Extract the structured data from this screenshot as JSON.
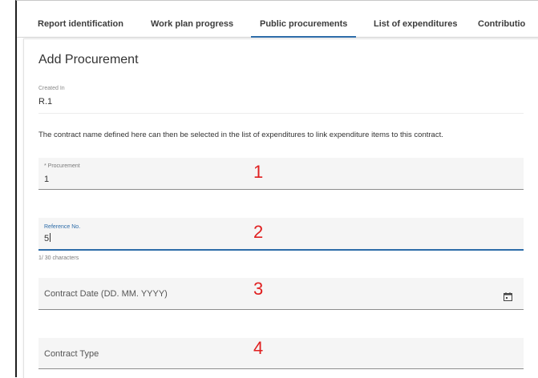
{
  "tabs": [
    {
      "label": "Report identification",
      "active": false
    },
    {
      "label": "Work plan progress",
      "active": false
    },
    {
      "label": "Public procurements",
      "active": true
    },
    {
      "label": "List of expenditures",
      "active": false
    },
    {
      "label": "Contributio",
      "active": false
    }
  ],
  "form": {
    "title": "Add Procurement",
    "created_in_label": "Created In",
    "created_in_value": "R.1",
    "info_text": "The contract name defined here can then be selected in the list of expenditures to link expenditure items to this contract.",
    "procurement": {
      "label": "* Procurement",
      "value": "1"
    },
    "reference": {
      "label": "Reference No.",
      "value": "5",
      "counter": "1/ 30 characters"
    },
    "contract_date": {
      "placeholder": "Contract Date (DD. MM. YYYY)",
      "icon": "calendar-icon"
    },
    "contract_type": {
      "placeholder": "Contract Type"
    }
  },
  "annotations": [
    "1",
    "2",
    "3",
    "4"
  ],
  "colors": {
    "accent": "#2d6ca8",
    "annotation": "#e02020"
  }
}
